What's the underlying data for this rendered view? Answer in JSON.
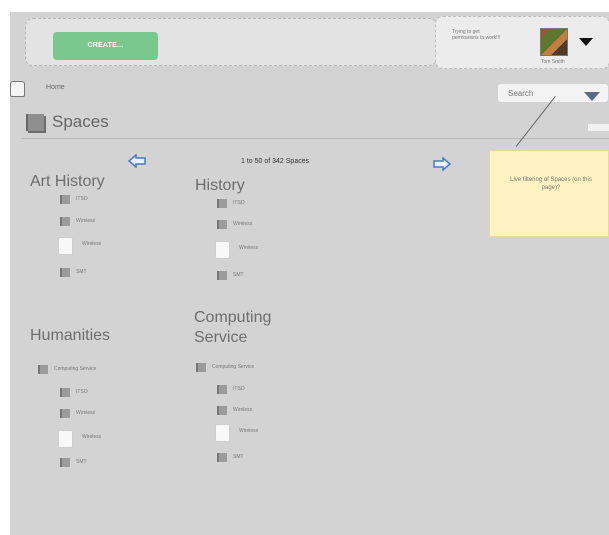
{
  "toolbar": {
    "create_label": "CREATE..."
  },
  "notice": {
    "text": "Trying to get permissions to work!!!"
  },
  "user": {
    "name": "Tom Smith"
  },
  "breadcrumb": {
    "home": "Home"
  },
  "search": {
    "placeholder": "Search"
  },
  "page": {
    "title": "Spaces",
    "pager_text": "1 to 50 of 342 Spaces"
  },
  "tooltip": {
    "text": "Live filtering of Spaces (on this page)?"
  },
  "groups": {
    "art_history": {
      "title": "Art History",
      "items": [
        "ITSO",
        "Wireless",
        "Wireless",
        "SMT"
      ]
    },
    "history": {
      "title": "History",
      "items": [
        "ITSO",
        "Wireless",
        "Wireless",
        "SMT"
      ]
    },
    "humanities": {
      "title": "Humanities",
      "items": [
        "Computing Service",
        "ITSO",
        "Wireless",
        "Wireless",
        "SMT"
      ]
    },
    "computing_service": {
      "title": "Computing Service",
      "items": [
        "Computing Service",
        "ITSO",
        "Wireless",
        "Wireless",
        "SMT"
      ]
    }
  },
  "icons": {
    "home": "home-icon",
    "spaces": "spaces-icon",
    "left_arrow": "arrow-left-icon",
    "right_arrow": "arrow-right-icon",
    "search_dropdown": "chevron-down-icon",
    "user_dropdown": "chevron-down-icon"
  },
  "colors": {
    "create_button": "#79c98f",
    "tooltip": "#fff2c2",
    "search_arrow": "#5e6a85"
  }
}
